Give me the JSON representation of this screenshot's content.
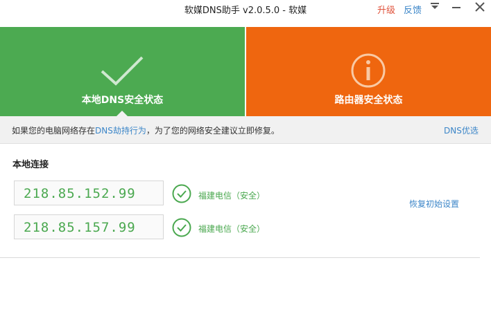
{
  "window": {
    "title": "软媒DNS助手 v2.0.5.0 - 软媒",
    "upgrade_label": "升级",
    "feedback_label": "反馈"
  },
  "panels": {
    "local": {
      "label": "本地DNS安全状态",
      "color": "#4caa51"
    },
    "router": {
      "label": "路由器安全状态",
      "color": "#ef660f"
    }
  },
  "notice": {
    "prefix": "如果您的电脑网络存在",
    "link": "DNS劫持行为",
    "suffix": "，为了您的网络安全建议立即修复。",
    "dns_optimize": "DNS优选"
  },
  "local_connection": {
    "title": "本地连接",
    "entries": [
      {
        "ip": "218.85.152.99",
        "status": "福建电信（安全）"
      },
      {
        "ip": "218.85.157.99",
        "status": "福建电信（安全）"
      }
    ],
    "restore_label": "恢复初始设置"
  },
  "icons": {
    "local_panel": "check-icon",
    "router_panel": "info-icon",
    "status": "check-circle-icon"
  }
}
